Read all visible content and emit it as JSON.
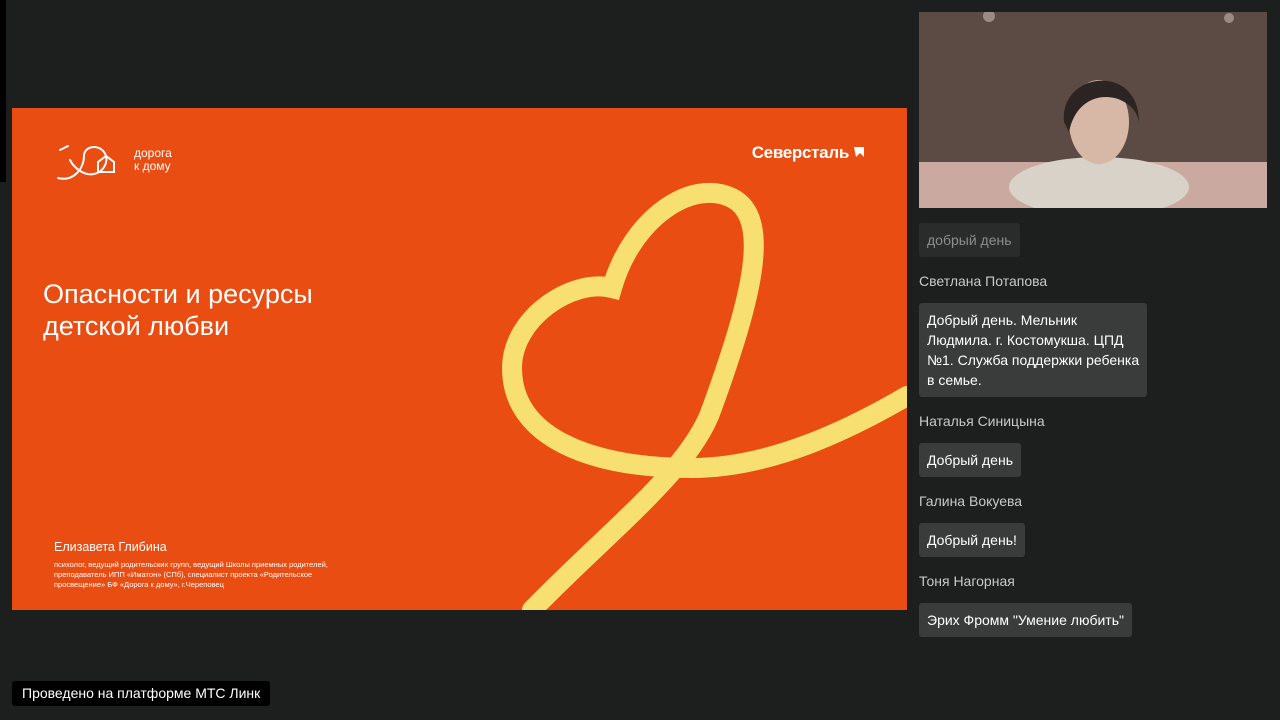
{
  "slide": {
    "logo_left_text": "дорога\nк дому",
    "logo_right_text": "Северсталь",
    "title": "Опасности и ресурсы\nдетской любви",
    "author_name": "Елизавета Глибина",
    "author_desc": "психолог, ведущий родительских групп, ведущий Школы приемных родителей,\nпреподаватель ИПП «Иматон» (СПб), специалист проекта «Родительское\nпросвещение» БФ «Дорога к дому», г.Череповец",
    "bg_color": "#ea4d12",
    "heart_color": "#f8df71"
  },
  "chat": {
    "top_message": "добрый день",
    "messages": [
      {
        "sender": "Светлана Потапова",
        "text": "Добрый день. Мельник\nЛюдмила. г. Костомукша. ЦПД\n№1. Служба поддержки ребенка\nв семье."
      },
      {
        "sender": "Наталья Синицына",
        "text": "Добрый день"
      },
      {
        "sender": "Галина Вокуева",
        "text": "Добрый день!"
      },
      {
        "sender": "Тоня Нагорная",
        "text": "Эрих Фромм \"Умение любить\""
      }
    ]
  },
  "footer": {
    "platform_text": "Проведено на платформе МТС Линк"
  }
}
